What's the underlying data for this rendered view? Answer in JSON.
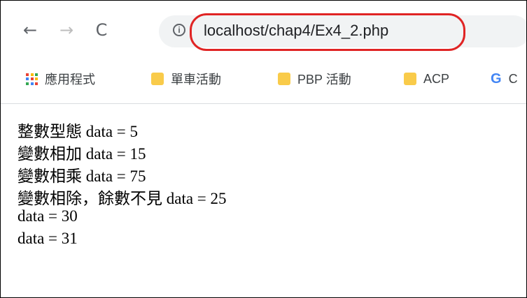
{
  "browser": {
    "url": "localhost/chap4/Ex4_2.php",
    "nav": {
      "back": "←",
      "forward": "→",
      "reload": "C",
      "info": "i"
    }
  },
  "bookmarks": [
    {
      "label": "應用程式",
      "icon": "apps-grid-icon"
    },
    {
      "label": "單車活動",
      "icon": "folder-icon"
    },
    {
      "label": "PBP 活動",
      "icon": "folder-icon"
    },
    {
      "label": "ACP",
      "icon": "folder-icon"
    },
    {
      "label": "C",
      "icon": "google-icon"
    }
  ],
  "content": {
    "lines": [
      {
        "cjk": "整數型態",
        "text": " data = 5"
      },
      {
        "cjk": "變數相加",
        "text": " data = 15"
      },
      {
        "cjk": "變數相乘",
        "text": " data = 75"
      },
      {
        "cjk": "變數相除，餘數不見",
        "text": " data = 25"
      },
      {
        "cjk": "",
        "text": "data = 30"
      },
      {
        "cjk": "",
        "text": "data = 31"
      }
    ]
  },
  "colors": {
    "highlight": "#e02424",
    "folder": "#f9cb4a"
  }
}
